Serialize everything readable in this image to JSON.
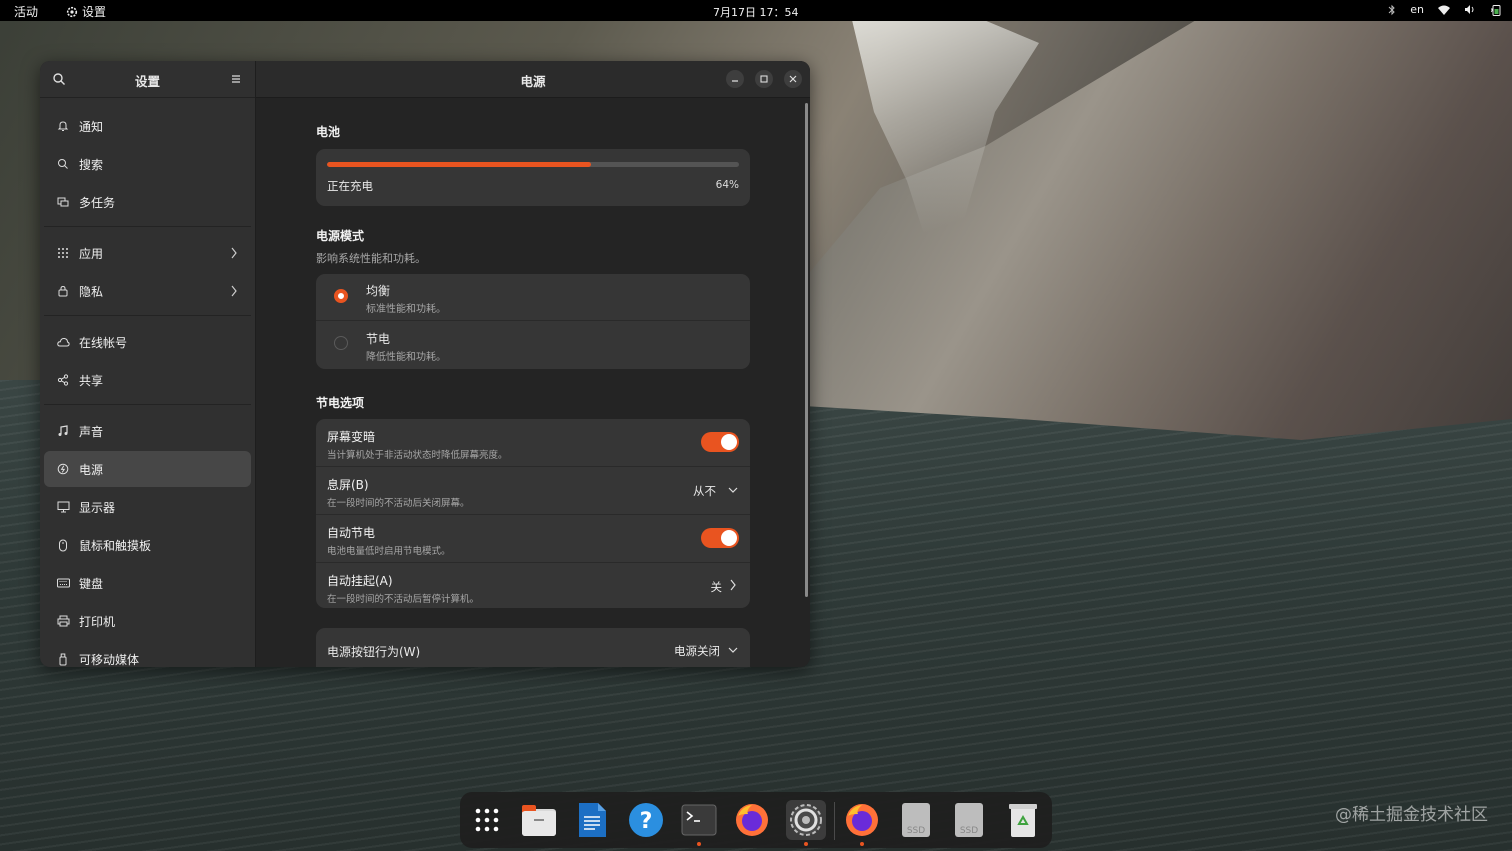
{
  "topbar": {
    "activities": "活动",
    "app_name": "设置",
    "clock": "7月17日  17：54",
    "lang": "en"
  },
  "sidebar": {
    "title": "设置",
    "items": [
      {
        "label": "通知",
        "icon": "bell-icon"
      },
      {
        "label": "搜索",
        "icon": "search-icon"
      },
      {
        "label": "多任务",
        "icon": "multitask-icon"
      },
      {
        "label": "应用",
        "icon": "grid-icon"
      },
      {
        "label": "隐私",
        "icon": "lock-icon"
      },
      {
        "label": "在线帐号",
        "icon": "cloud-icon"
      },
      {
        "label": "共享",
        "icon": "share-icon"
      },
      {
        "label": "声音",
        "icon": "music-note-icon"
      },
      {
        "label": "电源",
        "icon": "power-icon"
      },
      {
        "label": "显示器",
        "icon": "monitor-icon"
      },
      {
        "label": "鼠标和触摸板",
        "icon": "mouse-icon"
      },
      {
        "label": "键盘",
        "icon": "keyboard-icon"
      },
      {
        "label": "打印机",
        "icon": "printer-icon"
      },
      {
        "label": "可移动媒体",
        "icon": "usb-icon"
      }
    ]
  },
  "content": {
    "title": "电源",
    "battery": {
      "heading": "电池",
      "status": "正在充电",
      "percent_label": "64%",
      "level": 0.64
    },
    "power_mode": {
      "heading": "电源模式",
      "subtitle": "影响系统性能和功耗。",
      "options": [
        {
          "title": "均衡",
          "desc": "标准性能和功耗。",
          "selected": true
        },
        {
          "title": "节电",
          "desc": "降低性能和功耗。",
          "selected": false
        }
      ]
    },
    "saving": {
      "heading": "节电选项",
      "rows": [
        {
          "title": "屏幕变暗",
          "desc": "当计算机处于非活动状态时降低屏幕亮度。",
          "toggle": true
        },
        {
          "title": "息屏(B)",
          "desc": "在一段时间的不活动后关闭屏幕。",
          "value": "从不"
        },
        {
          "title": "自动节电",
          "desc": "电池电量低时启用节电模式。",
          "toggle": true
        },
        {
          "title": "自动挂起(A)",
          "desc": "在一段时间的不活动后暂停计算机。",
          "value": "关"
        }
      ]
    },
    "power_button": {
      "title": "电源按钮行为(W)",
      "value": "电源关闭"
    }
  },
  "dock": [
    "app-grid",
    "files",
    "writer",
    "help",
    "terminal",
    "firefox",
    "settings",
    "firefox",
    "ssd-drive",
    "ssd-drive",
    "trash"
  ],
  "watermark": "@稀土掘金技术社区",
  "colors": {
    "accent": "#e95420",
    "window_bg": "#242424",
    "sidebar_bg": "#303030",
    "card_bg": "#363636"
  }
}
